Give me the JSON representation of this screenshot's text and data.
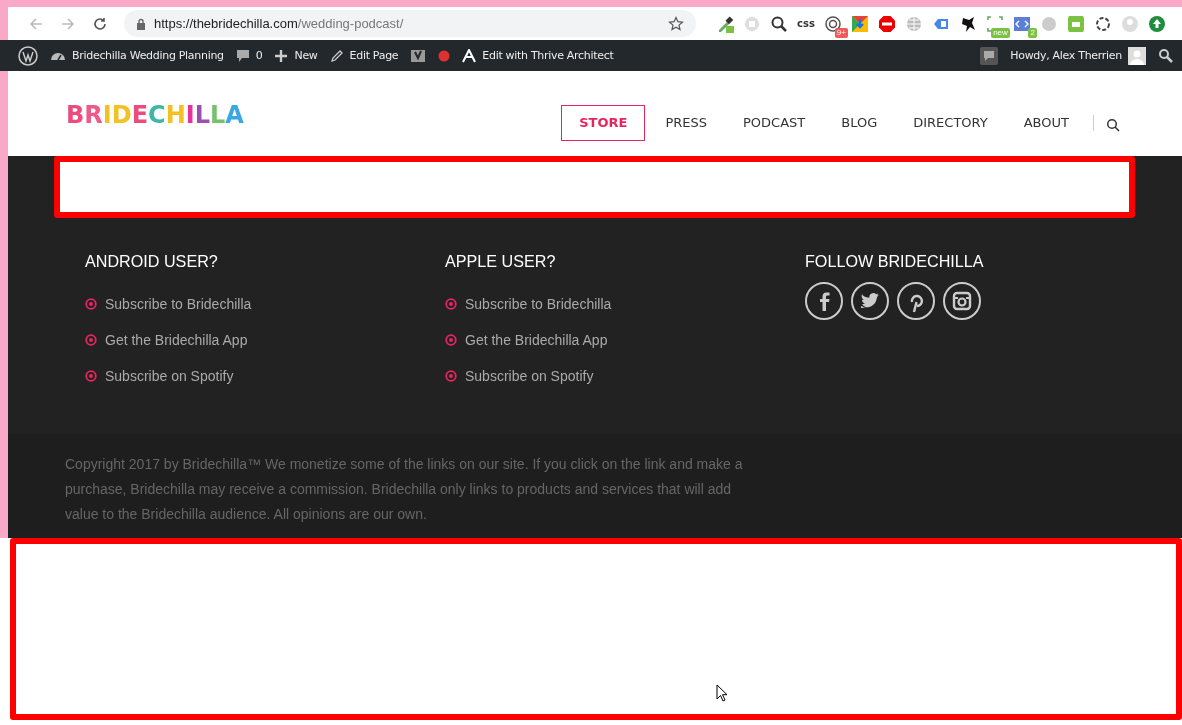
{
  "browser": {
    "url_host": "https://thebridechilla.com",
    "url_path": "/wedding-podcast/",
    "css_label": "css",
    "badges": [
      {
        "kind": "count",
        "text": "9+"
      },
      {
        "kind": "new",
        "text": "new"
      },
      {
        "kind": "num",
        "text": "2"
      }
    ]
  },
  "admin_bar": {
    "site": "Bridechilla Wedding Planning",
    "comments": "0",
    "new": "New",
    "edit": "Edit Page",
    "thrive": "Edit with Thrive Architect",
    "howdy": "Howdy, Alex Therrien"
  },
  "header": {
    "logo": "BRIDECHILLA",
    "nav": [
      {
        "label": "STORE",
        "selected": true
      },
      {
        "label": "PRESS",
        "selected": false
      },
      {
        "label": "PODCAST",
        "selected": false
      },
      {
        "label": "BLOG",
        "selected": false
      },
      {
        "label": "DIRECTORY",
        "selected": false
      },
      {
        "label": "ABOUT",
        "selected": false
      }
    ]
  },
  "footer": {
    "columns": [
      {
        "kind": "links",
        "heading": "ANDROID USER?",
        "links": [
          "Subscribe to Bridechilla",
          "Get the Bridechilla App",
          "Subscribe on Spotify"
        ]
      },
      {
        "kind": "links",
        "heading": "APPLE USER?",
        "links": [
          "Subscribe to Bridechilla",
          "Get the Bridechilla App",
          "Subscribe on Spotify"
        ]
      },
      {
        "kind": "social",
        "heading": "FOLLOW BRIDECHILLA"
      }
    ],
    "copyright": "Copyright 2017 by Bridechilla™ We monetize some of the links on our site. If you click on the link and make a purchase, Bridechilla may receive a commission. Bridechilla only links to products and services that will add value to the Bridechilla audience. All opinions are our own."
  }
}
